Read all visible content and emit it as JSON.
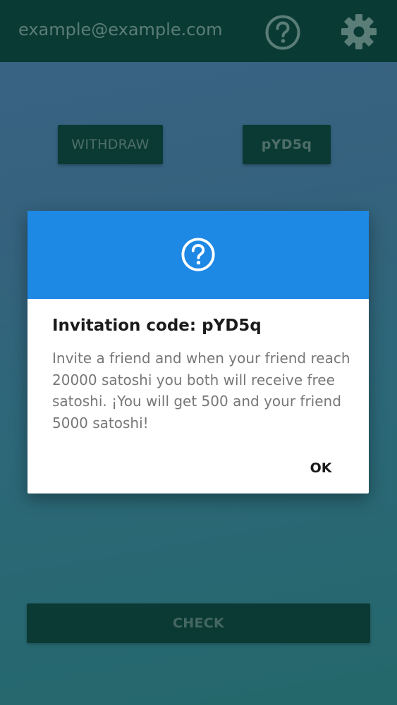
{
  "appbar": {
    "email": "example@example.com",
    "help_icon": "help-circle-icon",
    "settings_icon": "gear-icon"
  },
  "main": {
    "withdraw_label": "WITHDRAW",
    "code_label": "pYD5q",
    "check_label": "CHECK"
  },
  "dialog": {
    "icon": "help-circle-icon",
    "title": "Invitation code: pYD5q",
    "message": "Invite a friend and when your friend reach 20000 satoshi you both will receive free satoshi. ¡You will get 500 and your friend 5000 satoshi!",
    "ok_label": "OK"
  },
  "colors": {
    "appbar_bg": "#0a3a34",
    "dialog_header": "#1e88e5",
    "button_bg": "#0b3a34"
  }
}
